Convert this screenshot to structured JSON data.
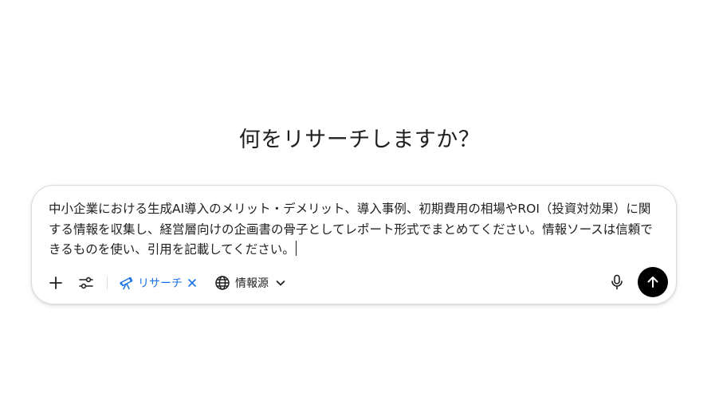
{
  "heading": "何をリサーチしますか？",
  "prompt": {
    "value": "中小企業における生成AI導入のメリット・デメリット、導入事例、初期費用の相場やROI（投資対効果）に関する情報を収集し、経営層向けの企画書の骨子としてレポート形式でまとめてください。情報ソースは信頼できるものを使い、引用を記載してください。"
  },
  "toolbar": {
    "add_icon": "plus-icon",
    "tools_icon": "sliders-icon",
    "research_chip": {
      "label": "リサーチ",
      "icon": "telescope-icon",
      "remove_icon": "close-icon",
      "color": "#1a73e8"
    },
    "sources_chip": {
      "label": "情報源",
      "icon": "globe-icon",
      "dropdown_icon": "chevron-down-icon"
    },
    "mic_icon": "microphone-icon",
    "send_icon": "arrow-up-icon"
  }
}
